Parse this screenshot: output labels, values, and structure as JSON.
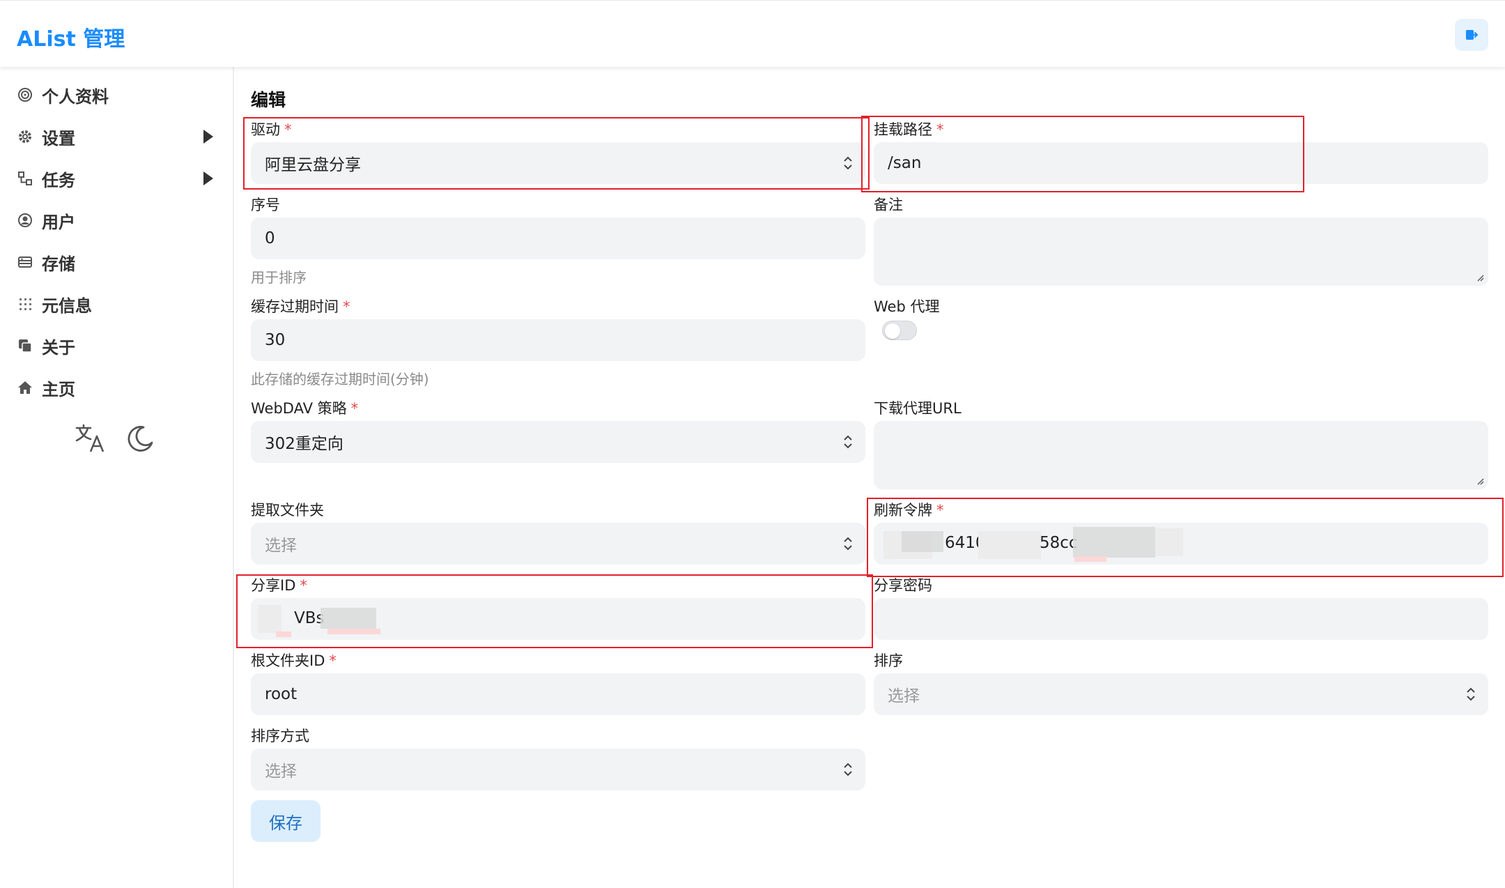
{
  "app": {
    "title": "AList 管理"
  },
  "sidebar": {
    "items": [
      {
        "label": "个人资料",
        "icon": "fingerprint-icon"
      },
      {
        "label": "设置",
        "icon": "gear-icon"
      },
      {
        "label": "任务",
        "icon": "tasks-icon"
      },
      {
        "label": "用户",
        "icon": "user-circle-icon"
      },
      {
        "label": "存储",
        "icon": "storage-icon"
      },
      {
        "label": "元信息",
        "icon": "meta-grid-icon"
      },
      {
        "label": "关于",
        "icon": "copy-icon"
      },
      {
        "label": "主页",
        "icon": "home-icon"
      }
    ]
  },
  "form": {
    "title": "编辑",
    "driver": {
      "label": "驱动",
      "value": "阿里云盘分享"
    },
    "mount_path": {
      "label": "挂载路径",
      "value": "/san"
    },
    "order": {
      "label": "序号",
      "value": "0",
      "hint": "用于排序"
    },
    "remark": {
      "label": "备注",
      "value": ""
    },
    "cache_expiration": {
      "label": "缓存过期时间",
      "value": "30",
      "hint": "此存储的缓存过期时间(分钟)"
    },
    "web_proxy": {
      "label": "Web 代理",
      "enabled": false
    },
    "webdav_policy": {
      "label": "WebDAV 策略",
      "value": "302重定向"
    },
    "download_proxy_url": {
      "label": "下载代理URL",
      "value": ""
    },
    "extract_folder": {
      "label": "提取文件夹",
      "placeholder": "选择"
    },
    "refresh_token": {
      "label": "刷新令牌",
      "visible_part_1": "6410",
      "visible_part_2": "58cc"
    },
    "share_id": {
      "label": "分享ID",
      "visible_part": "VBs"
    },
    "share_password": {
      "label": "分享密码",
      "value": ""
    },
    "root_folder_id": {
      "label": "根文件夹ID",
      "value": "root"
    },
    "order_by": {
      "label": "排序",
      "placeholder": "选择"
    },
    "order_direction": {
      "label": "排序方式",
      "placeholder": "选择"
    },
    "save_label": "保存"
  },
  "colors": {
    "brand": "#1a8cff",
    "required": "#e5484d",
    "field_bg": "#f1f3f5",
    "highlight": "#e2202a"
  }
}
